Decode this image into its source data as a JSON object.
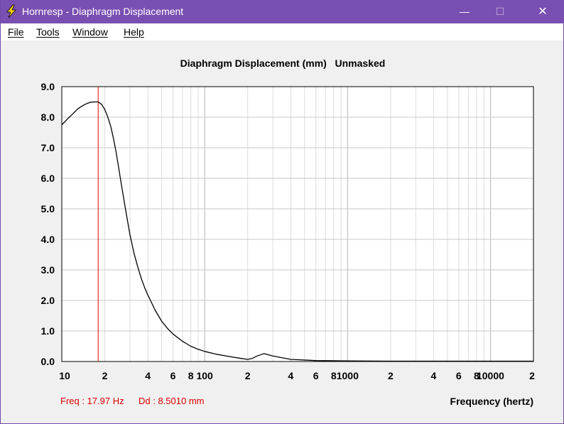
{
  "window": {
    "title": "Hornresp - Diaphragm Displacement",
    "minimize_glyph": "—",
    "maximize_glyph": "☐",
    "close_glyph": "✕",
    "icon": "lightning-bolt-icon"
  },
  "menubar": {
    "items": [
      {
        "label": "File",
        "accel": "F",
        "rest": "ile"
      },
      {
        "label": "Tools",
        "accel": "T",
        "rest": "ools"
      },
      {
        "label": "Window",
        "accel": "W",
        "rest": "indow"
      },
      {
        "label": "Help",
        "accel": "H",
        "rest": "elp"
      }
    ]
  },
  "readout": {
    "freq": "Freq : 17.97 Hz",
    "dd": "Dd : 8.5010 mm"
  },
  "colors": {
    "title_bar": "#7a4fb2",
    "curve": "#000000",
    "cursor": "#e00000",
    "grid": "#c8c8c8"
  },
  "chart_data": {
    "type": "line",
    "title": "Diaphragm Displacement (mm)",
    "title_suffix": "Unmasked",
    "xlabel": "Frequency (hertz)",
    "ylabel": "",
    "x_scale": "log",
    "xlim": [
      10,
      20000
    ],
    "ylim": [
      0,
      9
    ],
    "grid": true,
    "y_ticks": [
      "0.0",
      "1.0",
      "2.0",
      "3.0",
      "4.0",
      "5.0",
      "6.0",
      "7.0",
      "8.0",
      "9.0"
    ],
    "x_tick_labels": [
      {
        "value": 10,
        "label": "10"
      },
      {
        "value": 20,
        "label": "2"
      },
      {
        "value": 40,
        "label": "4"
      },
      {
        "value": 60,
        "label": "6"
      },
      {
        "value": 80,
        "label": "8"
      },
      {
        "value": 100,
        "label": "100"
      },
      {
        "value": 200,
        "label": "2"
      },
      {
        "value": 400,
        "label": "4"
      },
      {
        "value": 600,
        "label": "6"
      },
      {
        "value": 800,
        "label": "8"
      },
      {
        "value": 1000,
        "label": "1000"
      },
      {
        "value": 2000,
        "label": "2"
      },
      {
        "value": 4000,
        "label": "4"
      },
      {
        "value": 6000,
        "label": "6"
      },
      {
        "value": 8000,
        "label": "8"
      },
      {
        "value": 10000,
        "label": "10000"
      },
      {
        "value": 20000,
        "label": "2"
      }
    ],
    "cursor_x": 17.97,
    "series": [
      {
        "x": [
          10,
          11,
          12,
          13,
          14,
          15,
          16,
          17,
          17.97,
          19,
          20,
          21,
          22,
          23,
          24,
          25,
          26,
          28,
          30,
          32,
          34,
          36,
          38,
          40,
          45,
          50,
          55,
          60,
          70,
          80,
          90,
          100,
          120,
          150,
          180,
          200,
          215,
          230,
          260,
          300,
          400,
          600,
          1000,
          2000,
          5000,
          10000,
          20000
        ],
        "y": [
          7.75,
          7.95,
          8.12,
          8.28,
          8.38,
          8.45,
          8.49,
          8.5,
          8.5,
          8.42,
          8.25,
          8.0,
          7.7,
          7.3,
          6.85,
          6.35,
          5.85,
          4.95,
          4.15,
          3.55,
          3.1,
          2.72,
          2.42,
          2.18,
          1.68,
          1.32,
          1.08,
          0.9,
          0.66,
          0.5,
          0.4,
          0.33,
          0.24,
          0.16,
          0.1,
          0.07,
          0.1,
          0.17,
          0.26,
          0.18,
          0.07,
          0.03,
          0.02,
          0.01,
          0.01,
          0.01,
          0.01
        ]
      }
    ]
  }
}
